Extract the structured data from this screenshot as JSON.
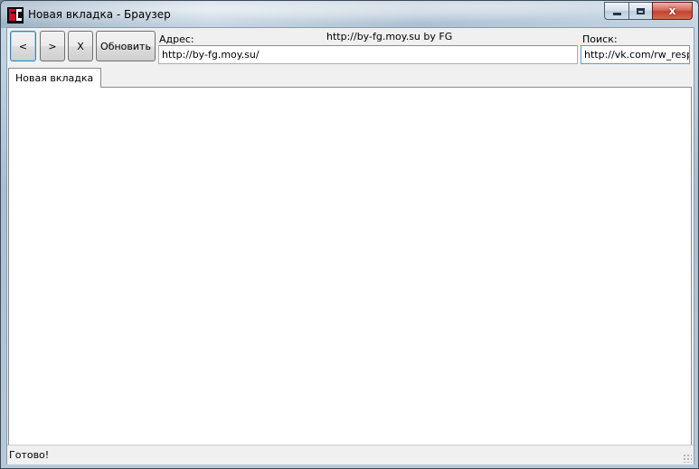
{
  "window": {
    "title": "Новая вкладка - Браузер",
    "close_symbol": "x"
  },
  "toolbar": {
    "back_label": "<",
    "forward_label": ">",
    "stop_label": "X",
    "refresh_label": "Обновить"
  },
  "address": {
    "label": "Адрес:",
    "value": "http://by-fg.moy.su/"
  },
  "banner": "http://by-fg.moy.su by FG",
  "search": {
    "label": "Поиск:",
    "value": "http://vk.com/rw_respe"
  },
  "tabs": [
    {
      "label": "Новая вкладка",
      "active": true
    }
  ],
  "status": {
    "text": "Готово!"
  },
  "colors": {
    "close_button": "#c44232",
    "title_bar": "#b7c9d9",
    "focus_border": "#3c7fb1"
  }
}
